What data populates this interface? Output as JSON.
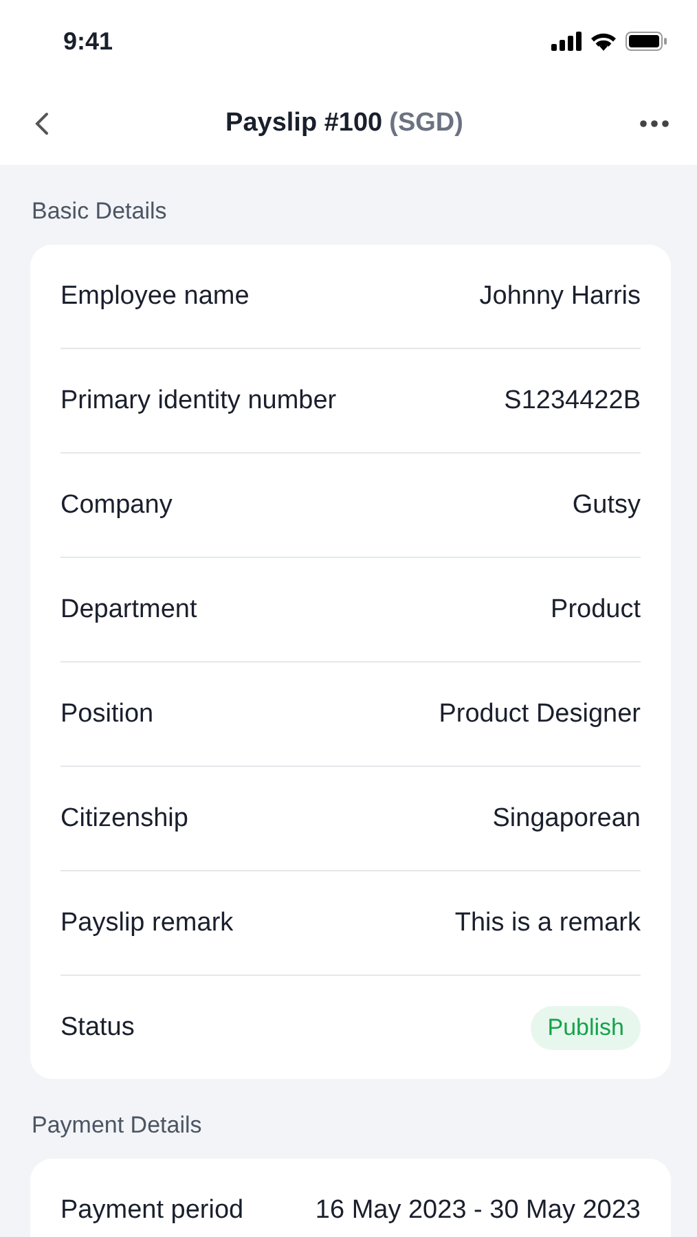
{
  "status_bar": {
    "time": "9:41"
  },
  "header": {
    "title": "Payslip #100",
    "currency": "(SGD)"
  },
  "sections": [
    {
      "title": "Basic Details",
      "rows": [
        {
          "kind": "text",
          "label": "Employee name",
          "value": "Johnny Harris"
        },
        {
          "kind": "text",
          "label": "Primary identity number",
          "value": "S1234422B"
        },
        {
          "kind": "text",
          "label": "Company",
          "value": "Gutsy"
        },
        {
          "kind": "text",
          "label": "Department",
          "value": "Product"
        },
        {
          "kind": "text",
          "label": "Position",
          "value": "Product Designer"
        },
        {
          "kind": "text",
          "label": "Citizenship",
          "value": "Singaporean"
        },
        {
          "kind": "text",
          "label": "Payslip remark",
          "value": "This is a remark"
        },
        {
          "kind": "badge",
          "label": "Status",
          "value": "Publish",
          "color": "#16a34a"
        }
      ]
    },
    {
      "title": "Payment Details",
      "rows": [
        {
          "kind": "text",
          "label": "Payment period",
          "value": "16 May 2023 - 30 May 2023"
        }
      ]
    }
  ]
}
